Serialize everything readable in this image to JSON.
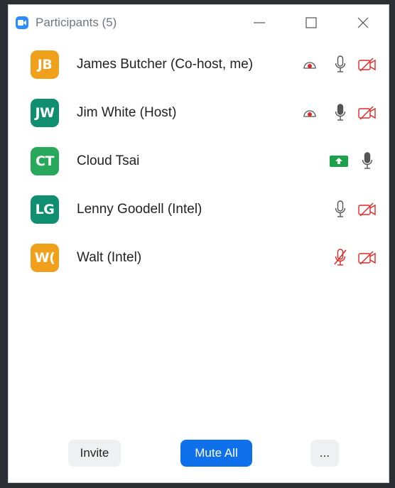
{
  "window": {
    "title": "Participants (5)",
    "controls": [
      "minimize-icon",
      "maximize-icon",
      "close-icon"
    ]
  },
  "participants": [
    {
      "initials": "JB",
      "name": "James Butcher (Co-host, me)",
      "avatar_color": "#f0a01b",
      "icons": [
        "record-icon",
        "microphone-icon",
        "video-off-icon"
      ]
    },
    {
      "initials": "JW",
      "name": "Jim White (Host)",
      "avatar_color": "#0f8f6f",
      "icons": [
        "record-icon",
        "microphone-icon",
        "video-off-icon"
      ]
    },
    {
      "initials": "CT",
      "name": "Cloud Tsai",
      "avatar_color": "#27a85a",
      "icons": [
        "screen-share-icon",
        "microphone-icon"
      ]
    },
    {
      "initials": "LG",
      "name": "Lenny Goodell (Intel)",
      "avatar_color": "#0f8f6f",
      "icons": [
        "microphone-icon",
        "video-off-icon"
      ]
    },
    {
      "initials": "W(",
      "name": "Walt (Intel)",
      "avatar_color": "#f0a01b",
      "icons": [
        "microphone-muted-icon",
        "video-off-icon"
      ]
    }
  ],
  "footer": {
    "invite_label": "Invite",
    "mute_all_label": "Mute All",
    "more_label": "..."
  },
  "colors": {
    "accent": "#0e71eb",
    "danger": "#e02828",
    "share_green": "#1aa34a"
  }
}
